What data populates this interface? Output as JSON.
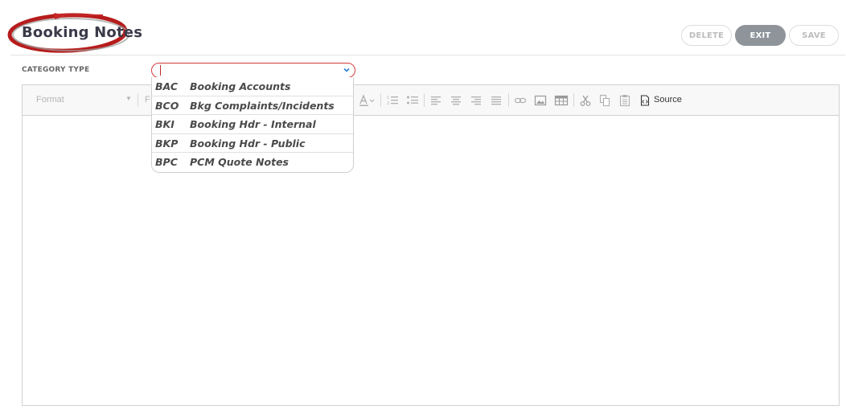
{
  "header": {
    "title": "Booking Notes",
    "buttons": {
      "delete": "DELETE",
      "exit": "EXIT",
      "save": "SAVE"
    }
  },
  "category": {
    "label": "CATEGORY TYPE",
    "selected_value": "",
    "options": [
      {
        "code": "BAC",
        "name": "Booking Accounts"
      },
      {
        "code": "BCO",
        "name": "Bkg Complaints/Incidents"
      },
      {
        "code": "BKI",
        "name": "Booking Hdr - Internal"
      },
      {
        "code": "BKP",
        "name": "Booking Hdr - Public"
      },
      {
        "code": "BPC",
        "name": "PCM Quote Notes"
      }
    ]
  },
  "editor": {
    "toolbar": {
      "format_label": "Format",
      "font_label": "F",
      "source_label": "Source",
      "icons": [
        "font-color-icon",
        "numbered-list-icon",
        "bulleted-list-icon",
        "align-left-icon",
        "align-center-icon",
        "align-right-icon",
        "justify-icon",
        "link-icon",
        "image-icon",
        "table-icon",
        "cut-icon",
        "copy-icon",
        "paste-icon",
        "source-icon"
      ]
    },
    "content": ""
  },
  "colors": {
    "accent_red": "#d33a3a",
    "exit_button": "#8e949a"
  }
}
